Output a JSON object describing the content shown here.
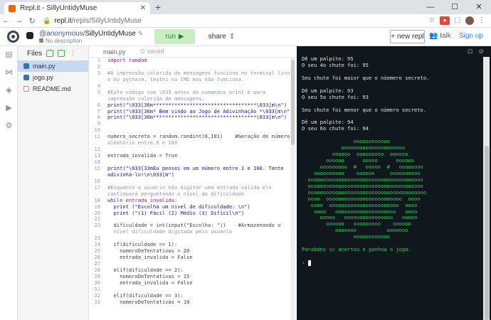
{
  "browser": {
    "tab_title": "Repl.it - SillyUntidyMuse",
    "url_host": "repl.it",
    "url_path": "/repls/SillyUntidyMuse",
    "new_tab": "+",
    "min": "—",
    "max": "☐",
    "close": "✕"
  },
  "header": {
    "user": "@anonymous",
    "project": "SillyUntidyMuse",
    "description": "No description",
    "run_label": "run",
    "share_label": "share",
    "new_repl": "+ new repl",
    "talk": "talk",
    "signup": "Sign up"
  },
  "files": {
    "title": "Files",
    "items": [
      {
        "name": "main.py"
      },
      {
        "name": "jogo.py"
      },
      {
        "name": "README.md"
      }
    ]
  },
  "editor": {
    "tab": "main.py",
    "saved": "saved",
    "lines": [
      {
        "n": "1",
        "t": "import random",
        "k": "kw"
      },
      {
        "n": "2",
        "t": "",
        "k": ""
      },
      {
        "n": "3",
        "t": "#A impressão colorida de mensagens funciona no terminal linux",
        "k": "cm"
      },
      {
        "n": "",
        "t": "e no pycharm, testei no CMD mas não funciona.",
        "k": "cm"
      },
      {
        "n": "4",
        "t": "",
        "k": ""
      },
      {
        "n": "5",
        "t": "#Este código com \\033 antes de comandos print é para",
        "k": "cm"
      },
      {
        "n": "",
        "t": "impressão colorida de mensagens.",
        "k": "cm"
      },
      {
        "n": "6",
        "t": "print(\"\\033[36m**********************************\\033[m\\n\")",
        "k": "fn"
      },
      {
        "n": "7",
        "t": "print(\"\\033[36m* Bem vindo ao Jogo de Adivinhação *\\033[m\\n\")",
        "k": "fn"
      },
      {
        "n": "8",
        "t": "print(\"\\033[36m**********************************\\033[m\\n\")",
        "k": "fn"
      },
      {
        "n": "9",
        "t": "",
        "k": ""
      },
      {
        "n": "10",
        "t": "",
        "k": ""
      },
      {
        "n": "11",
        "t": "numero_secreto = random.randint(0,101)    #Geração de número",
        "k": ""
      },
      {
        "n": "",
        "t": "aleatório entre 0 e 100",
        "k": "cm"
      },
      {
        "n": "12",
        "t": "",
        "k": ""
      },
      {
        "n": "13",
        "t": "entrada_invalida = True",
        "k": ""
      },
      {
        "n": "14",
        "t": "",
        "k": ""
      },
      {
        "n": "15",
        "t": "print(\"\\033[33mEu pensei em um número entre 1 e 100. Tente",
        "k": "fn"
      },
      {
        "n": "",
        "t": "adivinhá-lo!\\n\\033[m\")",
        "k": "fn"
      },
      {
        "n": "16",
        "t": "",
        "k": ""
      },
      {
        "n": "17",
        "t": "#Enquanto o usuário não digitar uma entrada válida ele",
        "k": "cm"
      },
      {
        "n": "",
        "t": "continuará perguntando o nível de dificuldade",
        "k": "cm"
      },
      {
        "n": "18",
        "t": "while entrada_invalida:",
        "k": "kw"
      },
      {
        "n": "19",
        "t": "  print (\"Escolha um nível de dificuldade: \\n\")",
        "k": "fn"
      },
      {
        "n": "20",
        "t": "  print (\"(1) Fácil (2) Médio (3) Difícil\\n\")",
        "k": "fn"
      },
      {
        "n": "21",
        "t": "",
        "k": ""
      },
      {
        "n": "22",
        "t": "  dificuldade = int(input(\"Escolha: \"))    #Armazenando o",
        "k": ""
      },
      {
        "n": "",
        "t": "  nível dificuldade digitada pelo usuário",
        "k": "cm"
      },
      {
        "n": "23",
        "t": "",
        "k": ""
      },
      {
        "n": "24",
        "t": "  if(dificuldade == 1):",
        "k": ""
      },
      {
        "n": "25",
        "t": "    numeroDeTentativas = 20",
        "k": ""
      },
      {
        "n": "26",
        "t": "    entrada_invalida = False",
        "k": ""
      },
      {
        "n": "27",
        "t": "",
        "k": ""
      },
      {
        "n": "28",
        "t": "  elif(dificuldade == 2):",
        "k": ""
      },
      {
        "n": "29",
        "t": "    numeroDeTentativas = 15",
        "k": ""
      },
      {
        "n": "30",
        "t": "    entrada_invalida = False",
        "k": ""
      },
      {
        "n": "31",
        "t": "",
        "k": ""
      },
      {
        "n": "32",
        "t": "  elif(dificuldade == 3):",
        "k": ""
      },
      {
        "n": "33",
        "t": "    numeroDeTentativas = 10",
        "k": ""
      }
    ]
  },
  "console": {
    "lines": [
      {
        "t": "Dê um palpite: 95",
        "k": ""
      },
      {
        "t": "O seu 4o chute foi: 95",
        "k": ""
      },
      {
        "t": "",
        "k": ""
      },
      {
        "t": "Seu chute foi maior que o núemero secreto.",
        "k": ""
      },
      {
        "t": "",
        "k": ""
      },
      {
        "t": "Dê um palpite: 93",
        "k": ""
      },
      {
        "t": "O seu 5o chute foi: 93",
        "k": ""
      },
      {
        "t": "",
        "k": ""
      },
      {
        "t": "Seu chute foi menor que o número secreto.",
        "k": ""
      },
      {
        "t": "",
        "k": ""
      },
      {
        "t": "Dê um palpite: 94",
        "k": ""
      },
      {
        "t": "O seu 6o chute foi: 94",
        "k": ""
      },
      {
        "t": "",
        "k": ""
      },
      {
        "t": "                 oooooooooooo",
        "k": "g"
      },
      {
        "t": "             ooooooooooooooooooooo",
        "k": "g"
      },
      {
        "t": "          oooooo  ooooooooo  oooooo",
        "k": "g"
      },
      {
        "t": "        oooooo      ooooo      oooooo",
        "k": "g"
      },
      {
        "t": "      ooooooooo  #   ooooo  #   oooooooo",
        "k": "g"
      },
      {
        "t": "    oooooooooo    oooooo     oooooooooo",
        "k": "g"
      },
      {
        "t": "  oooooooooooooooooooooooooooooooooooooo",
        "k": "g"
      },
      {
        "t": "  oooooooooooooooooooooooooooooooooooooo",
        "k": "g"
      },
      {
        "t": "  ooooooooooooooooooooooooooooooooooooooo",
        "k": "g"
      },
      {
        "t": "  oooo  ooooooooooooooooooooooooo  oooo",
        "k": "g"
      },
      {
        "t": "   oooo  ooooooooooooooooooooooo  oooo",
        "k": "g"
      },
      {
        "t": "    oooo   oooooooooooooooooooo   oooo",
        "k": "g"
      },
      {
        "t": "      ooooo   oooooooooooooooo   ooooo",
        "k": "g"
      },
      {
        "t": "        oooooo   ooooooooo    oooooo",
        "k": "g"
      },
      {
        "t": "           ooooooo          ooooooo",
        "k": "g"
      },
      {
        "t": "                 oooooooooooo",
        "k": "g"
      },
      {
        "t": "",
        "k": ""
      },
      {
        "t": "Parabéns vc acertou e ganhou o jogo.",
        "k": "g"
      },
      {
        "t": "",
        "k": ""
      }
    ],
    "prompt": "›"
  }
}
